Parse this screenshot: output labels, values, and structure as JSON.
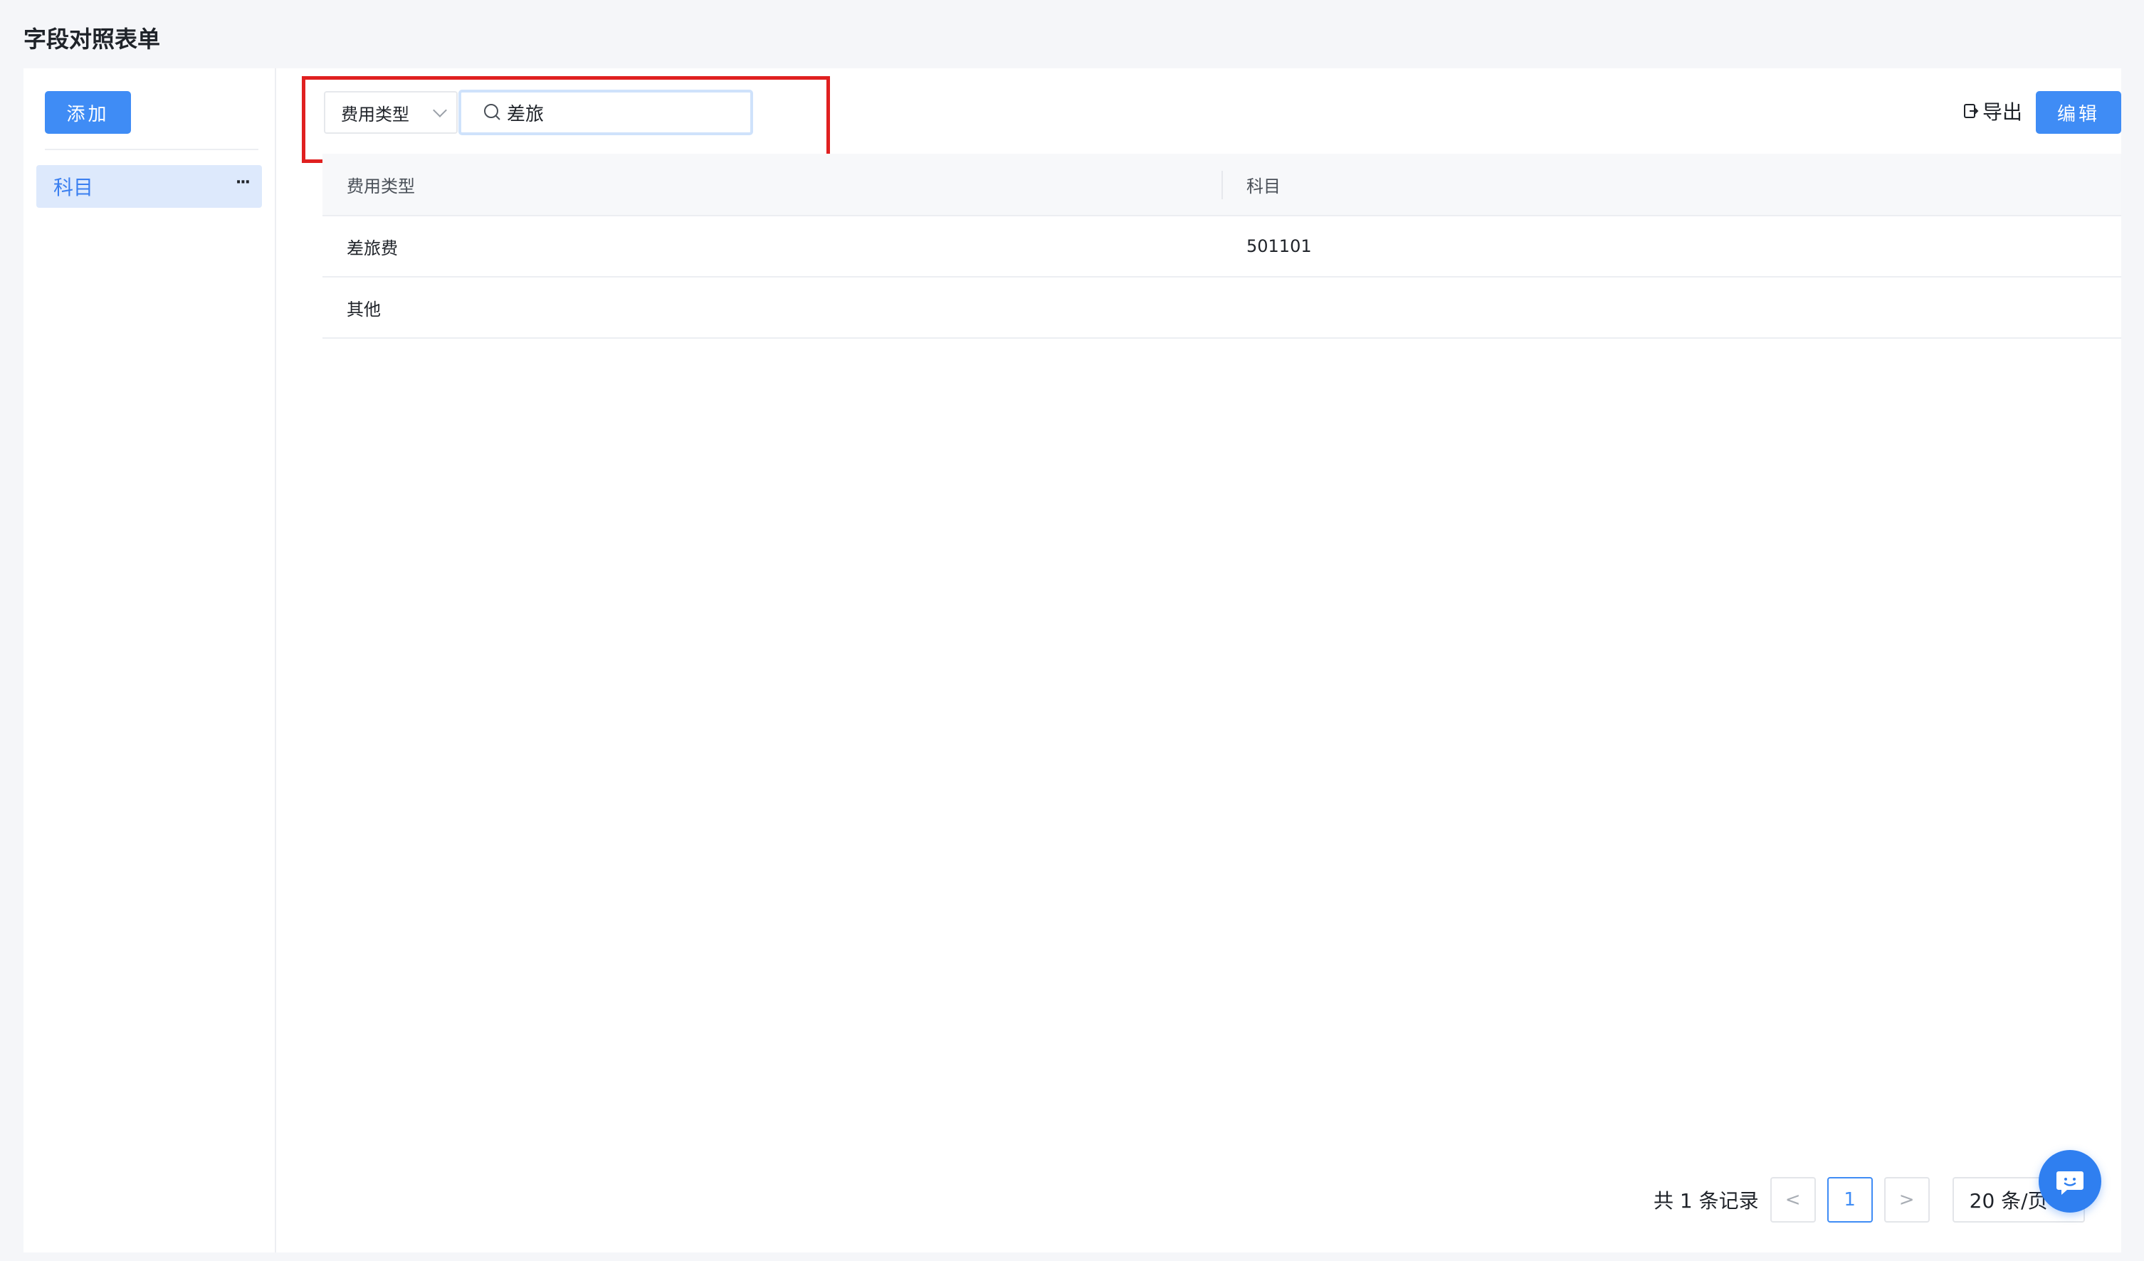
{
  "page": {
    "title": "字段对照表单"
  },
  "sidebar": {
    "add_label": "添加",
    "items": [
      {
        "label": "科目",
        "more": "···"
      }
    ]
  },
  "toolbar": {
    "filter_select": "费用类型",
    "search_value": "差旅",
    "export_label": "导出",
    "edit_label": "编辑"
  },
  "table": {
    "columns": [
      "费用类型",
      "科目"
    ],
    "rows": [
      [
        "差旅费",
        "501101"
      ],
      [
        "其他",
        ""
      ]
    ]
  },
  "pagination": {
    "total_text": "共 1 条记录",
    "prev": "<",
    "current_page": "1",
    "next": ">",
    "page_size": "20 条/页"
  },
  "colors": {
    "accent": "#3f8cf5",
    "highlight": "#e02020",
    "selected_bg": "#dde9fc"
  }
}
